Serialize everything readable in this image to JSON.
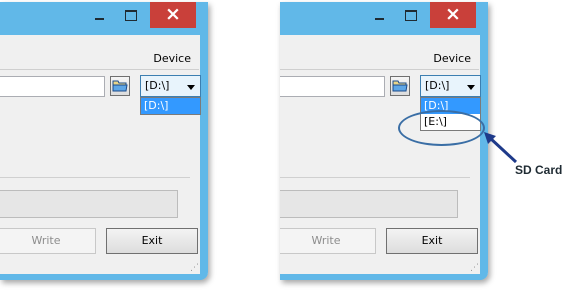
{
  "panels": [
    {
      "device_label": "Device",
      "selected_device": "[D:\\]",
      "dropdown_options": [
        "[D:\\]"
      ],
      "write_label": "Write",
      "exit_label": "Exit"
    },
    {
      "device_label": "Device",
      "selected_device": "[D:\\]",
      "dropdown_options": [
        "[D:\\]",
        "[E:\\]"
      ],
      "write_label": "Write",
      "exit_label": "Exit"
    }
  ],
  "annotation": {
    "label": "SD Card",
    "color": "#1e3a8a"
  },
  "colors": {
    "title_bar": "#61b8e8",
    "close_button": "#c9403a",
    "selection": "#3399ff"
  },
  "icons": [
    "minimize-icon",
    "maximize-icon",
    "close-icon",
    "folder-icon",
    "chevron-down-icon",
    "resize-grip-icon",
    "arrow-icon"
  ]
}
